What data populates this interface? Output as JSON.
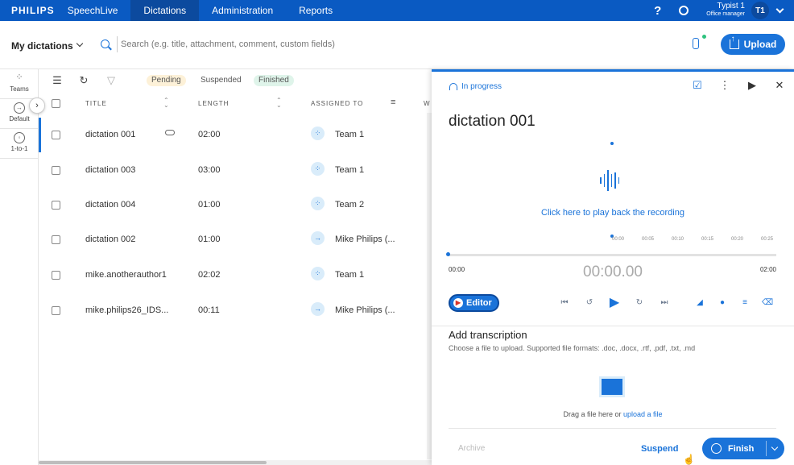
{
  "topbar": {
    "brand": "PHILIPS",
    "product": "SpeechLive",
    "tabs": [
      {
        "label": "Dictations",
        "active": true
      },
      {
        "label": "Administration",
        "active": false
      },
      {
        "label": "Reports",
        "active": false
      }
    ],
    "help": "?",
    "user_name": "Typist 1",
    "user_role": "Office manager",
    "avatar": "T1"
  },
  "toolbar": {
    "my_dictations": "My dictations",
    "search_placeholder": "Search (e.g. title, attachment, comment, custom fields)",
    "upload": "Upload"
  },
  "rail": {
    "items": [
      {
        "label": "Teams",
        "icon": "teams-icon"
      },
      {
        "label": "Default",
        "icon": "default-icon"
      },
      {
        "label": "1-to-1",
        "icon": "one-to-one-icon"
      }
    ]
  },
  "filters": {
    "pending": "Pending",
    "suspended": "Suspended",
    "finished": "Finished"
  },
  "table": {
    "columns": {
      "title": "TITLE",
      "length": "LENGTH",
      "assigned": "ASSIGNED TO",
      "w": "W"
    },
    "rows": [
      {
        "title": "dictation 001",
        "length": "02:00",
        "assigned": "Team 1",
        "kind": "team",
        "attachment": true
      },
      {
        "title": "dictation 003",
        "length": "03:00",
        "assigned": "Team 1",
        "kind": "team",
        "attachment": false
      },
      {
        "title": "dictation 004",
        "length": "01:00",
        "assigned": "Team 2",
        "kind": "team",
        "attachment": false
      },
      {
        "title": "dictation 002",
        "length": "01:00",
        "assigned": "Mike Philips (...",
        "kind": "user",
        "attachment": false
      },
      {
        "title": "mike.anotherauthor1",
        "length": "02:02",
        "assigned": "Team 1",
        "kind": "team",
        "attachment": false
      },
      {
        "title": "mike.philips26_IDS...",
        "length": "00:11",
        "assigned": "Mike Philips (...",
        "kind": "user",
        "attachment": false
      }
    ]
  },
  "panel": {
    "status": "In progress",
    "title": "dictation 001",
    "playback": "Click here to play back the recording",
    "ruler_ticks": [
      "00:00",
      "00:05",
      "00:10",
      "00:15",
      "00:20",
      "00:25"
    ],
    "time_start": "00:00",
    "time_current": "00:00.00",
    "time_end": "02:00",
    "editor": "Editor",
    "add_transcription": "Add transcription",
    "transcription_hint": "Choose a file to upload. Supported file formats: .doc, .docx, .rtf, .pdf, .txt, .md",
    "drag_text": "Drag a file here or ",
    "upload_link": "upload a file",
    "archive": "Archive",
    "suspend": "Suspend",
    "finish": "Finish"
  },
  "colors": {
    "accent": "#1a73d9",
    "topbar": "#0a5ac2"
  }
}
